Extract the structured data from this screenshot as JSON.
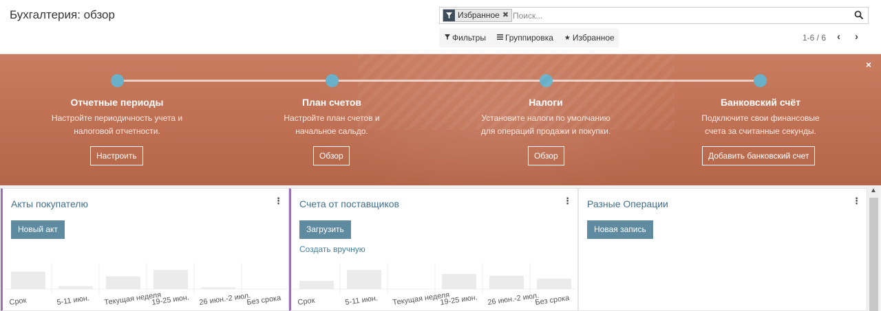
{
  "page": {
    "title": "Бухгалтерия: обзор"
  },
  "search": {
    "facet_label": "Избранное",
    "facet_remove": "✖",
    "facet_icon": "filter-icon",
    "placeholder": "Поиск..."
  },
  "filters": {
    "filters_label": "Фильтры",
    "groupby_label": "Группировка",
    "favorites_label": "Избранное"
  },
  "pager": {
    "value": "1-6 / 6",
    "prev": "‹",
    "next": "›"
  },
  "banner": {
    "close": "×",
    "steps": [
      {
        "title": "Отчетные периоды",
        "desc1": "Настройте периодичность учета и",
        "desc2": "налоговой отчетности.",
        "button": "Настроить"
      },
      {
        "title": "План счетов",
        "desc1": "Настройте план счетов и",
        "desc2": "начальное сальдо.",
        "button": "Обзор"
      },
      {
        "title": "Налоги",
        "desc1": "Установите налоги по умолчанию",
        "desc2": "для операций продажи и покупки.",
        "button": "Обзор"
      },
      {
        "title": "Банковский счёт",
        "desc1": "Подключите свои финансовые",
        "desc2": "счета за считанные секунды.",
        "button": "Добавить банковский счет"
      }
    ]
  },
  "cards": [
    {
      "title": "Акты покупателю",
      "button": "Новый акт"
    },
    {
      "title": "Счета от поставщиков",
      "button": "Загрузить",
      "link": "Создать вручную"
    },
    {
      "title": "Разные Операции",
      "button": "Новая запись"
    }
  ],
  "colors": {
    "banner": "#c27456",
    "dot": "#6ab0c8",
    "button": "#5f8ba1",
    "accent": "#9b6fb5",
    "title": "#3f6f8b"
  },
  "chart_data": [
    {
      "type": "bar",
      "categories": [
        "Срок",
        "5-11 июн.",
        "Текущая неделя",
        "19-25 июн.",
        "26 июн.-2 июл.",
        "Без срока"
      ],
      "values": [
        30,
        5,
        22,
        33,
        3,
        0
      ],
      "ylim": [
        0,
        45
      ]
    },
    {
      "type": "bar",
      "categories": [
        "Срок",
        "5-11 июн.",
        "Текущая неделя",
        "19-25 июн.",
        "26 июн.-2 июл.",
        "Без срока"
      ],
      "values": [
        14,
        33,
        0,
        26,
        23,
        18
      ],
      "ylim": [
        0,
        45
      ]
    }
  ]
}
